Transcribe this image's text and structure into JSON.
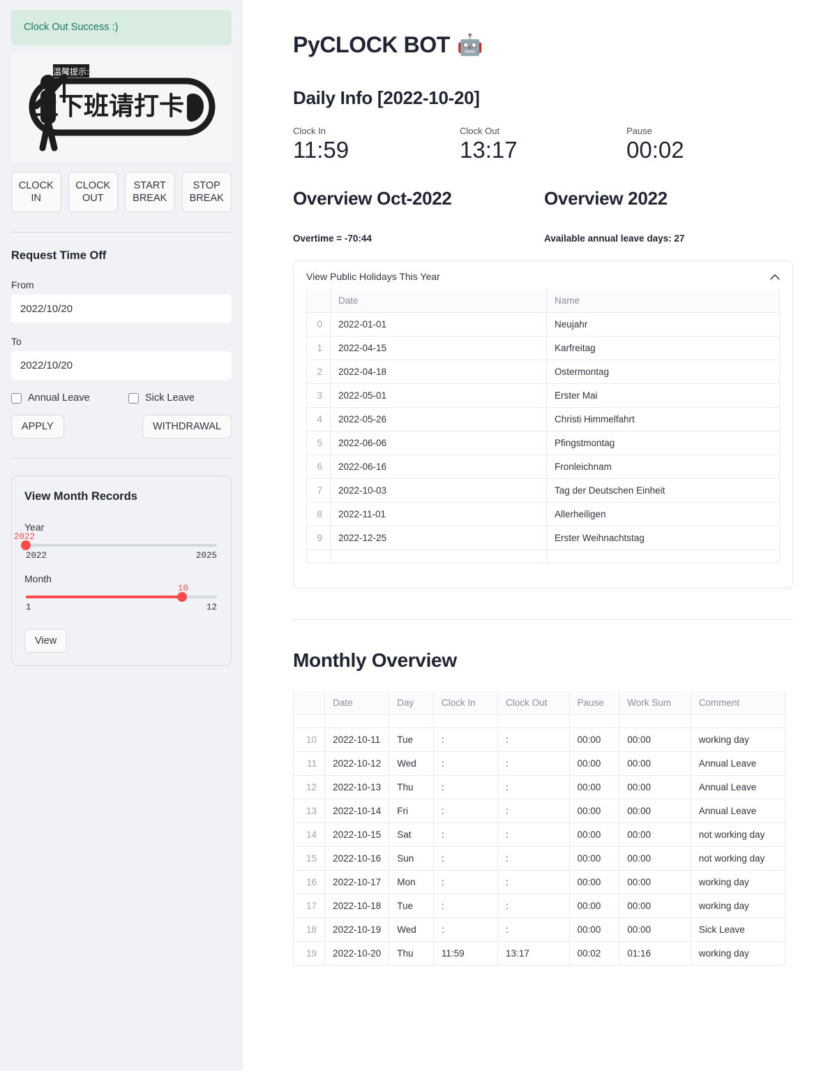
{
  "sidebar": {
    "alert": "Clock Out Success :)",
    "banner_alt": "chinese-clock-in-reminder-banner",
    "clock_buttons": [
      {
        "name": "clock-in",
        "label": "CLOCK\nIN",
        "line1": "CLOCK",
        "line2": "IN"
      },
      {
        "name": "clock-out",
        "label": "CLOCK\nOUT",
        "line1": "CLOCK",
        "line2": "OUT"
      },
      {
        "name": "start-break",
        "label": "START\nBREAK",
        "line1": "START",
        "line2": "BREAK"
      },
      {
        "name": "stop-break",
        "label": "STOP\nBREAK",
        "line1": "STOP",
        "line2": "BREAK"
      }
    ],
    "time_off": {
      "title": "Request Time Off",
      "from_label": "From",
      "from_value": "2022/10/20",
      "to_label": "To",
      "to_value": "2022/10/20",
      "annual_leave_label": "Annual Leave",
      "sick_leave_label": "Sick Leave",
      "apply_label": "APPLY",
      "withdrawal_label": "WITHDRAWAL"
    },
    "month_records": {
      "title": "View Month Records",
      "year_label": "Year",
      "year_value": "2022",
      "year_min": "2022",
      "year_max": "2025",
      "year_pct": 0,
      "month_label": "Month",
      "month_value": "10",
      "month_min": "1",
      "month_max": "12",
      "month_pct": 81.8,
      "view_label": "View"
    }
  },
  "main": {
    "app_title": "PyCLOCK BOT",
    "bot_icon": "🤖",
    "daily_info_title": "Daily Info [2022-10-20]",
    "metrics": [
      {
        "label": "Clock In",
        "value": "11:59"
      },
      {
        "label": "Clock Out",
        "value": "13:17"
      },
      {
        "label": "Pause",
        "value": "00:02"
      }
    ],
    "overview_month_title": "Overview Oct-2022",
    "overview_year_title": "Overview 2022",
    "overtime_text": "Overtime = -70:44",
    "annual_leave_text": "Available annual leave days: 27",
    "expander": {
      "label": "View Public Holidays This Year",
      "chevron": "⌃",
      "columns": [
        "",
        "Date",
        "Name"
      ],
      "rows": [
        {
          "idx": "0",
          "date": "2022-01-01",
          "name": "Neujahr"
        },
        {
          "idx": "1",
          "date": "2022-04-15",
          "name": "Karfreitag"
        },
        {
          "idx": "2",
          "date": "2022-04-18",
          "name": "Ostermontag"
        },
        {
          "idx": "3",
          "date": "2022-05-01",
          "name": "Erster Mai"
        },
        {
          "idx": "4",
          "date": "2022-05-26",
          "name": "Christi Himmelfahrt"
        },
        {
          "idx": "5",
          "date": "2022-06-06",
          "name": "Pfingstmontag"
        },
        {
          "idx": "6",
          "date": "2022-06-16",
          "name": "Fronleichnam"
        },
        {
          "idx": "7",
          "date": "2022-10-03",
          "name": "Tag der Deutschen Einheit"
        },
        {
          "idx": "8",
          "date": "2022-11-01",
          "name": "Allerheiligen"
        },
        {
          "idx": "9",
          "date": "2022-12-25",
          "name": "Erster Weihnachtstag"
        }
      ]
    },
    "monthly_overview": {
      "title": "Monthly Overview",
      "columns": [
        "",
        "Date",
        "Day",
        "Clock In",
        "Clock Out",
        "Pause",
        "Work Sum",
        "Comment"
      ],
      "rows": [
        {
          "idx": "10",
          "date": "2022-10-11",
          "day": "Tue",
          "clock_in": ":",
          "clock_out": ":",
          "pause": "00:00",
          "work_sum": "00:00",
          "comment": "working day"
        },
        {
          "idx": "11",
          "date": "2022-10-12",
          "day": "Wed",
          "clock_in": ":",
          "clock_out": ":",
          "pause": "00:00",
          "work_sum": "00:00",
          "comment": "Annual Leave"
        },
        {
          "idx": "12",
          "date": "2022-10-13",
          "day": "Thu",
          "clock_in": ":",
          "clock_out": ":",
          "pause": "00:00",
          "work_sum": "00:00",
          "comment": "Annual Leave"
        },
        {
          "idx": "13",
          "date": "2022-10-14",
          "day": "Fri",
          "clock_in": ":",
          "clock_out": ":",
          "pause": "00:00",
          "work_sum": "00:00",
          "comment": "Annual Leave"
        },
        {
          "idx": "14",
          "date": "2022-10-15",
          "day": "Sat",
          "clock_in": ":",
          "clock_out": ":",
          "pause": "00:00",
          "work_sum": "00:00",
          "comment": "not working day"
        },
        {
          "idx": "15",
          "date": "2022-10-16",
          "day": "Sun",
          "clock_in": ":",
          "clock_out": ":",
          "pause": "00:00",
          "work_sum": "00:00",
          "comment": "not working day"
        },
        {
          "idx": "16",
          "date": "2022-10-17",
          "day": "Mon",
          "clock_in": ":",
          "clock_out": ":",
          "pause": "00:00",
          "work_sum": "00:00",
          "comment": "working day"
        },
        {
          "idx": "17",
          "date": "2022-10-18",
          "day": "Tue",
          "clock_in": ":",
          "clock_out": ":",
          "pause": "00:00",
          "work_sum": "00:00",
          "comment": "working day"
        },
        {
          "idx": "18",
          "date": "2022-10-19",
          "day": "Wed",
          "clock_in": ":",
          "clock_out": ":",
          "pause": "00:00",
          "work_sum": "00:00",
          "comment": "Sick Leave"
        },
        {
          "idx": "19",
          "date": "2022-10-20",
          "day": "Thu",
          "clock_in": "11:59",
          "clock_out": "13:17",
          "pause": "00:02",
          "work_sum": "01:16",
          "comment": "working day"
        }
      ]
    }
  },
  "colors": {
    "accent": "#ff4b4b",
    "sidebar_bg": "#f0f2f6",
    "success_bg": "#d8ece1",
    "success_text": "#17785c",
    "text": "#31333f"
  }
}
